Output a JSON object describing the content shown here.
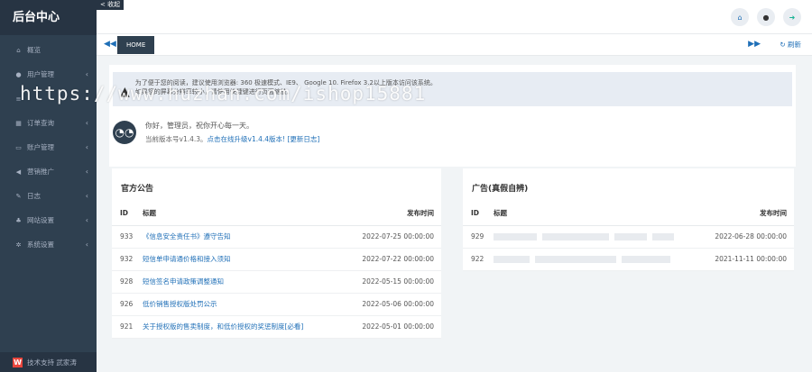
{
  "sidebar": {
    "brand": "后台中心",
    "items": [
      {
        "icon": "home-icon",
        "label": "概览",
        "has_children": false
      },
      {
        "icon": "users-icon",
        "label": "用户管理",
        "has_children": true
      },
      {
        "icon": "list-icon",
        "label": "",
        "has_children": true
      },
      {
        "icon": "calendar-icon",
        "label": "订单查询",
        "has_children": true
      },
      {
        "icon": "card-icon",
        "label": "账户管理",
        "has_children": true
      },
      {
        "icon": "bullhorn-icon",
        "label": "营销推广",
        "has_children": true
      },
      {
        "icon": "edit-icon",
        "label": "日志",
        "has_children": true
      },
      {
        "icon": "sitemap-icon",
        "label": "网站设置",
        "has_children": true
      },
      {
        "icon": "gear-icon",
        "label": "系统设置",
        "has_children": true
      }
    ],
    "footer": "技术支持 武家涛"
  },
  "header": {
    "collapse_label": "< 收起",
    "icons": [
      "home-icon",
      "user-icon",
      "logout-icon"
    ]
  },
  "tabs": {
    "home_label": "HOME",
    "refresh_label": "刷新"
  },
  "notice": {
    "line1": "为了便于您的阅读，建议使用浏览器: 360 极速模式、IE9、 Google 10. Firefox 3.2以上版本访问该系统。",
    "line2": "如果您的屏幕分辨率较小，请使用快捷键进行页面缩放。"
  },
  "user": {
    "greeting": "你好，管理员，祝你开心每一天。",
    "version_text": "当前版本号v1.4.3。",
    "upgrade_link": "点击在线升级v1.4.4版本!",
    "changelog_link": "[更新日志]"
  },
  "official": {
    "title": "官方公告",
    "headers": {
      "id": "ID",
      "title": "标题",
      "time": "发布时间"
    },
    "rows": [
      {
        "id": "933",
        "title": "《信息安全责任书》遵守告知",
        "time": "2022-07-25 00:00:00"
      },
      {
        "id": "932",
        "title": "短信单申请通价格和接入须知",
        "time": "2022-07-22 00:00:00"
      },
      {
        "id": "928",
        "title": "短信签名申请政策调整通知",
        "time": "2022-05-15 00:00:00"
      },
      {
        "id": "926",
        "title": "低价销售授权版处罚公示",
        "time": "2022-05-06 00:00:00"
      },
      {
        "id": "921",
        "title": "关于授权版的售卖制度，和低价授权的奖惩制度[必看]",
        "time": "2022-05-01 00:00:00"
      }
    ]
  },
  "ads": {
    "title": "广告(真假自辨)",
    "headers": {
      "id": "ID",
      "title": "标题",
      "time": "发布时间"
    },
    "rows": [
      {
        "id": "929",
        "time": "2022-06-28 00:00:00"
      },
      {
        "id": "922",
        "time": "2021-11-11 00:00:00"
      }
    ]
  },
  "watermark": "https://www.huzhan.com/ishop15881"
}
